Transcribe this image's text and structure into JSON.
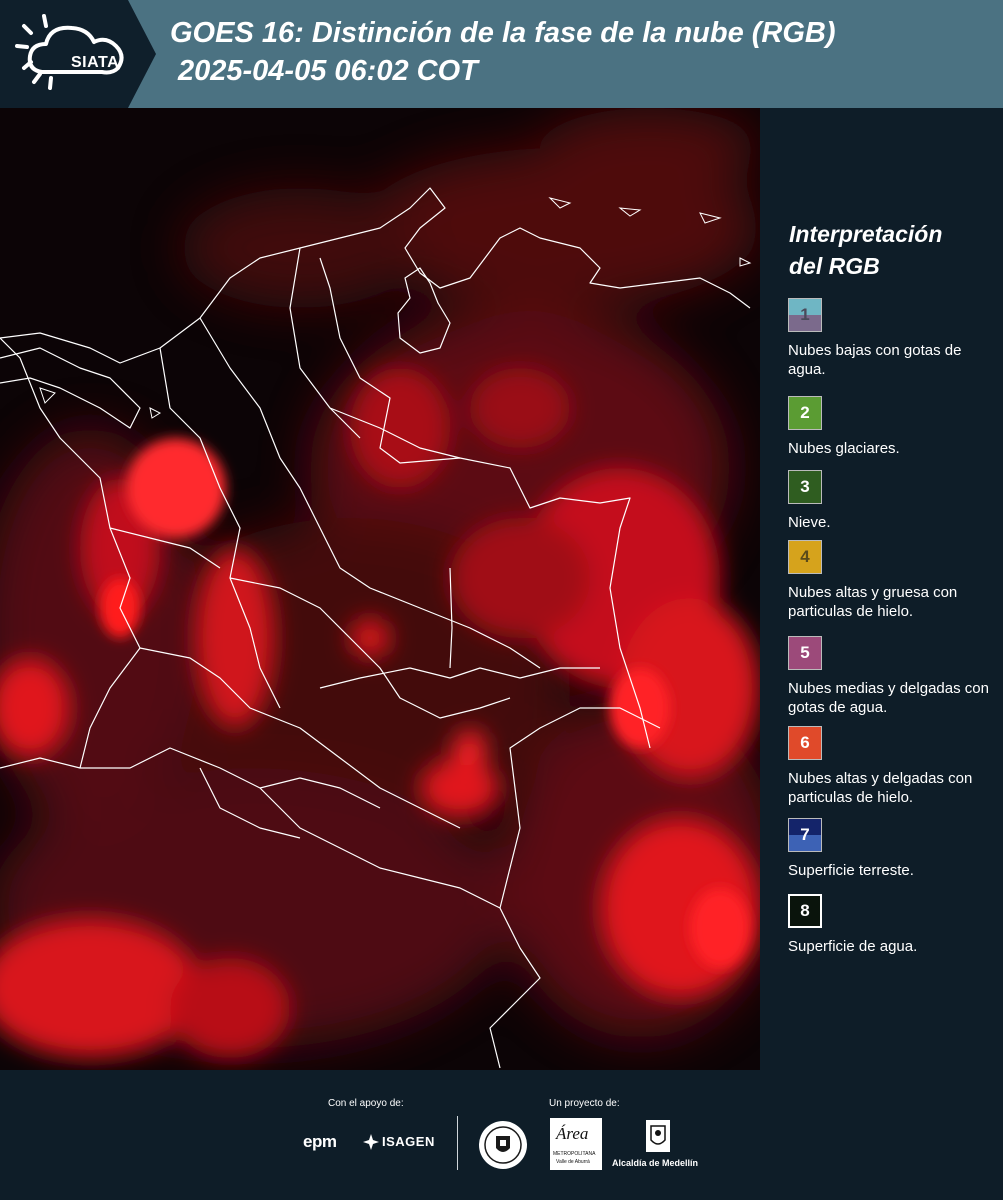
{
  "header": {
    "logo_text": "SIATA",
    "title": "GOES 16: Distinción de la fase de la nube (RGB)",
    "timestamp": "2025-04-05 06:02 COT"
  },
  "legend": {
    "title_line1": "Interpretación",
    "title_line2": "del RGB",
    "items": [
      {
        "number": "1",
        "label": "Nubes bajas con gotas de agua.",
        "color_top": "#6fb6c4",
        "color_bottom": "#7b6a8c",
        "num_color": "#4a4a5a"
      },
      {
        "number": "2",
        "label": "Nubes glaciares.",
        "color_top": "#5b9c33",
        "color_bottom": "#5b9c33",
        "num_color": "#ffffff"
      },
      {
        "number": "3",
        "label": "Nieve.",
        "color_top": "#2f5d20",
        "color_bottom": "#2f5d20",
        "num_color": "#ffffff"
      },
      {
        "number": "4",
        "label": "Nubes altas y gruesa con particulas de hielo.",
        "color_top": "#d6a31c",
        "color_bottom": "#d6a31c",
        "num_color": "#5a4a1a"
      },
      {
        "number": "5",
        "label": "Nubes medias y delgadas con gotas de agua.",
        "color_top": "#9c4a7a",
        "color_bottom": "#9c4a7a",
        "num_color": "#ffffff"
      },
      {
        "number": "6",
        "label": "Nubes altas y delgadas con particulas de hielo.",
        "color_top": "#e04a2a",
        "color_bottom": "#e04a2a",
        "num_color": "#ffffff"
      },
      {
        "number": "7",
        "label": "Superficie terreste.",
        "color_top": "#14246a",
        "color_bottom": "#3d62b5",
        "num_color": "#ffffff"
      },
      {
        "number": "8",
        "label": "Superficie de agua.",
        "color_top": "#0a140c",
        "color_bottom": "#0a140c",
        "num_color": "#ffffff"
      }
    ]
  },
  "footer": {
    "support_caption": "Con el apoyo de:",
    "project_caption": "Un proyecto de:",
    "epm_text": "epm",
    "isagen_text": "ISAGEN",
    "area_text": "Área",
    "area_sub": "METROPOLITANA",
    "area_sub2": "Valle de Aburrá",
    "medellin_text": "Alcaldía de Medellín"
  },
  "colors": {
    "header_band": "#4b7282",
    "panel": "#0e1d28",
    "cloud_red": "#ff1a1a"
  }
}
